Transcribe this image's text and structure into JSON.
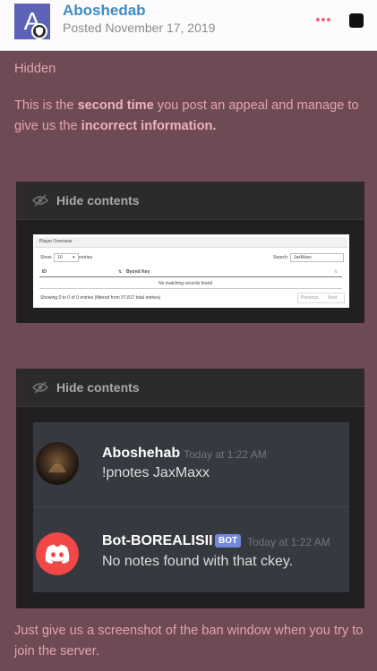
{
  "post": {
    "author": "Aboshedab",
    "avatar_letter": "A",
    "posted": "Posted November 17, 2019"
  },
  "body": {
    "hidden_label": "Hidden",
    "para1": {
      "p1": "This is the ",
      "b1": "second time",
      "p2": " you post an appeal and manage to give us the ",
      "b2": "incorrect information."
    },
    "closing": "Just give us a screenshot of the ban window when you try to join the server."
  },
  "spoilers": [
    {
      "title": "Hide contents"
    },
    {
      "title": "Hide contents"
    }
  ],
  "player_overview": {
    "title": "Player Overview",
    "show_label": "Show",
    "show_value": "10",
    "entries_label": "entries",
    "search_label": "Search:",
    "search_value": "JaxMaxx",
    "col_id": "ID",
    "col_key": "Byond Key",
    "empty": "No matching records found",
    "info": "Showing 0 to 0 of 0 entries (filtered from 37,817 total entries)",
    "prev": "Previous",
    "next": "Next"
  },
  "discord": {
    "msg1": {
      "name": "Aboshehab",
      "time": "Today at 1:22 AM",
      "text": "!pnotes JaxMaxx"
    },
    "msg2": {
      "name": "Bot-BOREALISII",
      "tag": "BOT",
      "time": "Today at 1:22 AM",
      "text": "No notes found with that ckey."
    }
  },
  "colors": {
    "background": "#6e4a55",
    "text": "#e1a4ae",
    "author": "#3e8bc5",
    "discord_bg": "#36393f",
    "bot_tag": "#7289da",
    "discord_logo": "#f04747"
  }
}
